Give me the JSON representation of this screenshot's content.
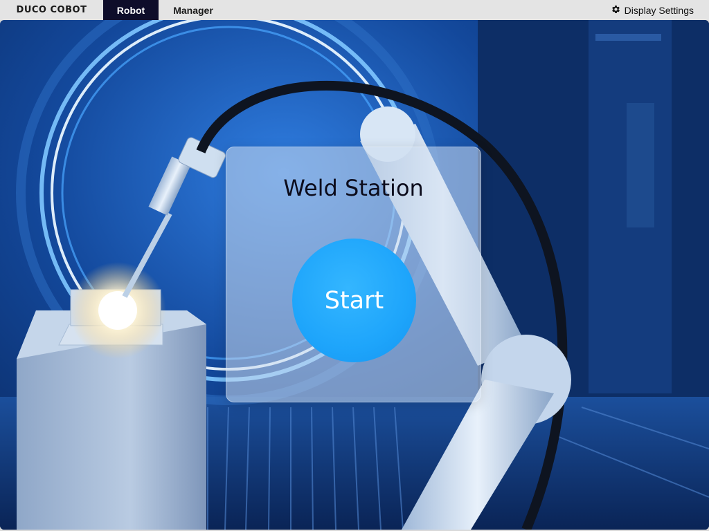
{
  "header": {
    "logo_text": "DUCO COBOT",
    "tabs": [
      {
        "label": "Robot",
        "active": true
      },
      {
        "label": "Manager",
        "active": false
      }
    ],
    "display_settings_label": "Display Settings",
    "display_settings_icon": "gear-icon"
  },
  "panel": {
    "title": "Weld Station",
    "start_label": "Start"
  },
  "colors": {
    "active_tab": "#0e0d2a",
    "start_button": "#1ea5fb",
    "topbar": "#e4e4e4"
  }
}
